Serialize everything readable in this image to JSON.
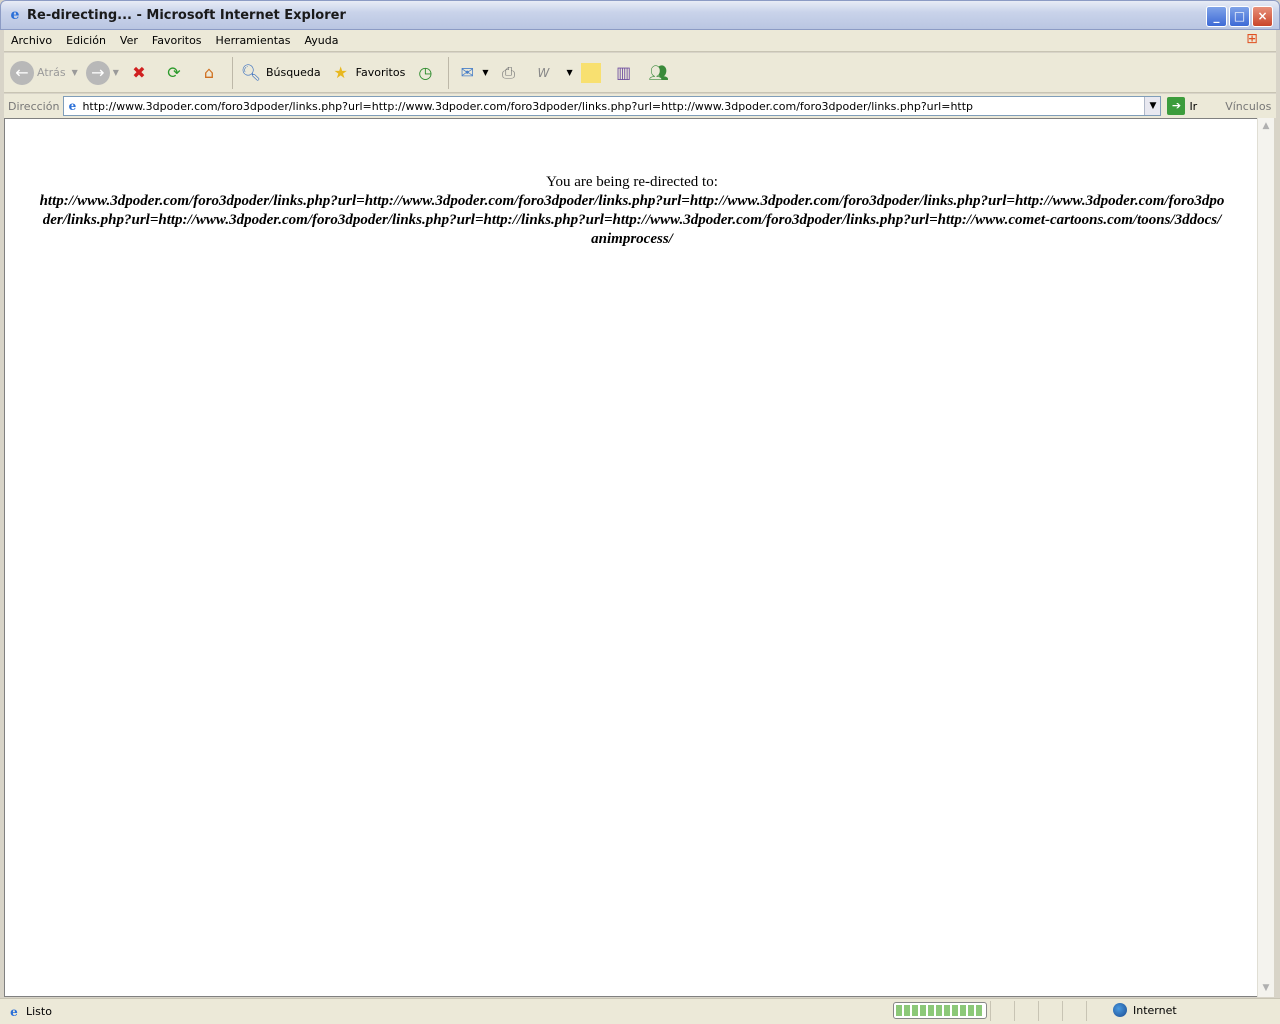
{
  "window": {
    "title": "Re-directing... - Microsoft Internet Explorer",
    "minimize": "_",
    "maximize": "□",
    "close": "×"
  },
  "menu": [
    "Archivo",
    "Edición",
    "Ver",
    "Favoritos",
    "Herramientas",
    "Ayuda"
  ],
  "toolbar": {
    "back": "Atrás",
    "search": "Búsqueda",
    "favorites": "Favoritos"
  },
  "address": {
    "label": "Dirección",
    "url": "http://www.3dpoder.com/foro3dpoder/links.php?url=http://www.3dpoder.com/foro3dpoder/links.php?url=http://www.3dpoder.com/foro3dpoder/links.php?url=http",
    "go": "Ir",
    "links": "Vínculos"
  },
  "page": {
    "message": "You are being re-directed to:",
    "redirect_url": "http://www.3dpoder.com/foro3dpoder/links.php?url=http://www.3dpoder.com/foro3dpoder/links.php?url=http://www.3dpoder.com/foro3dpoder/links.php?url=http://www.3dpoder.com/foro3dpoder/links.php?url=http://www.3dpoder.com/foro3dpoder/links.php?url=http://links.php?url=http://www.3dpoder.com/foro3dpoder/links.php?url=http://www.comet-cartoons.com/toons/3ddocs/animprocess/"
  },
  "status": {
    "text": "Listo",
    "zone": "Internet",
    "progress_percent": 100
  }
}
